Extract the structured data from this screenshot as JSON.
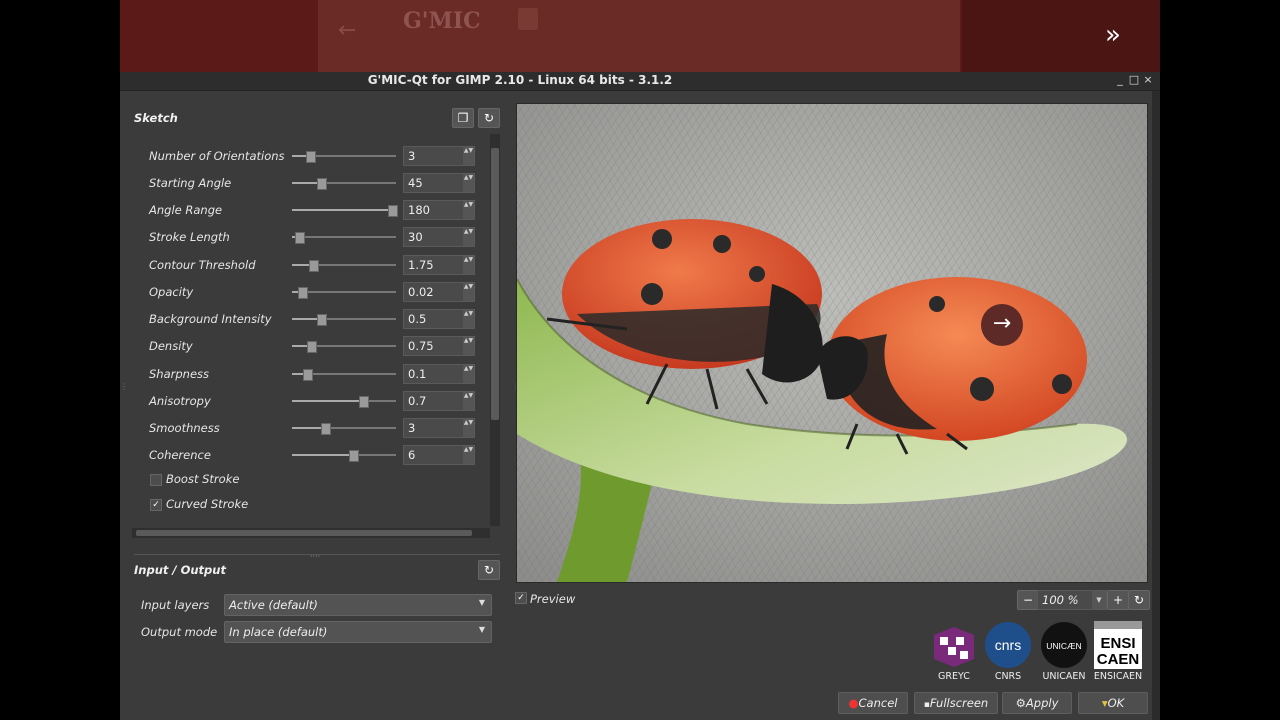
{
  "website": {
    "ghost_logo": "G'MIC",
    "next_slide_icon": "double-chevron-right-icon"
  },
  "window": {
    "title": "G'MIC-Qt for GIMP 2.10 - Linux 64 bits - 3.1.2",
    "controls": [
      "_",
      "□",
      "×"
    ]
  },
  "filter": {
    "title": "Sketch",
    "params": [
      {
        "label": "Number of Orientations",
        "value": "3",
        "pos": 0.17
      },
      {
        "label": "Starting Angle",
        "value": "45",
        "pos": 0.28
      },
      {
        "label": "Angle Range",
        "value": "180",
        "pos": 0.96
      },
      {
        "label": "Stroke Length",
        "value": "30",
        "pos": 0.07
      },
      {
        "label": "Contour Threshold",
        "value": "1.75",
        "pos": 0.2
      },
      {
        "label": "Opacity",
        "value": "0.02",
        "pos": 0.1
      },
      {
        "label": "Background Intensity",
        "value": "0.5",
        "pos": 0.28
      },
      {
        "label": "Density",
        "value": "0.75",
        "pos": 0.18
      },
      {
        "label": "Sharpness",
        "value": "0.1",
        "pos": 0.14
      },
      {
        "label": "Anisotropy",
        "value": "0.7",
        "pos": 0.68
      },
      {
        "label": "Smoothness",
        "value": "3",
        "pos": 0.32
      },
      {
        "label": "Coherence",
        "value": "6",
        "pos": 0.59
      }
    ],
    "checkboxes": [
      {
        "label": "Boost Stroke",
        "checked": false
      },
      {
        "label": "Curved Stroke",
        "checked": true
      }
    ]
  },
  "io": {
    "title": "Input / Output",
    "input_label": "Input layers",
    "input_value": "Active (default)",
    "output_label": "Output mode",
    "output_value": "In place (default)"
  },
  "preview": {
    "label": "Preview",
    "checked": true,
    "zoom": "100 %"
  },
  "logos": [
    "GREYC",
    "CNRS",
    "UNICAEN",
    "ENSICAEN"
  ],
  "logo_texts": {
    "cnrs": "cnrs",
    "unicaen": "UNICÆN",
    "ensicaen": [
      "ENSI",
      "CAEN"
    ]
  },
  "buttons": {
    "cancel": "Cancel",
    "fullscreen": "Fullscreen",
    "apply": "Apply",
    "ok": "OK"
  }
}
